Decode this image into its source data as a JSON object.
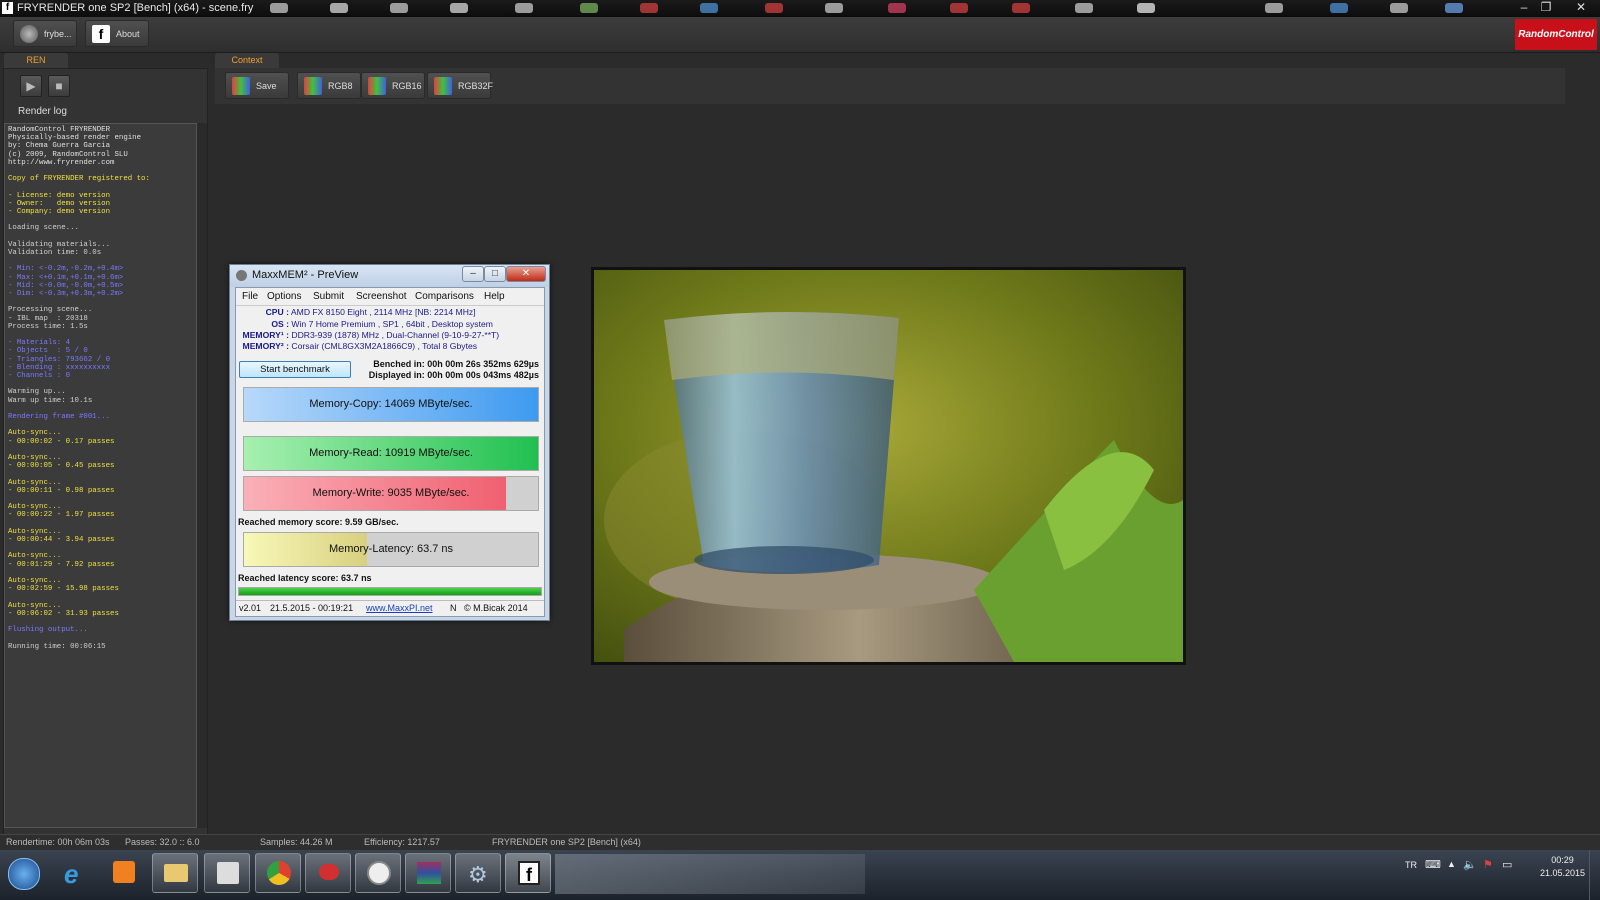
{
  "window": {
    "title": "FRYRENDER one SP2 [Bench] (x64) - scene.fry",
    "controls": [
      "–",
      "❐",
      "✕"
    ]
  },
  "toolbar": {
    "user_label": "frybe...",
    "about_label": "About",
    "brand": "RandomControl"
  },
  "left": {
    "tab": "REN",
    "render_log_label": "Render log",
    "log": [
      {
        "t": "RandomControl FRYRENDER",
        "c": "w"
      },
      {
        "t": "Physically-based render engine",
        "c": "w"
      },
      {
        "t": "by: Chema Guerra Garcia",
        "c": "w"
      },
      {
        "t": "(c) 2009, RandomControl SLU",
        "c": "w"
      },
      {
        "t": "http://www.fryrender.com",
        "c": "w"
      },
      {
        "t": "",
        "c": "w"
      },
      {
        "t": "Copy of FRYRENDER registered to:",
        "c": "y"
      },
      {
        "t": "",
        "c": "w"
      },
      {
        "t": "- License: demo version",
        "c": "y"
      },
      {
        "t": "- Owner:   demo version",
        "c": "y"
      },
      {
        "t": "- Company: demo version",
        "c": "y"
      },
      {
        "t": "",
        "c": "w"
      },
      {
        "t": "Loading scene...",
        "c": "g"
      },
      {
        "t": "",
        "c": "w"
      },
      {
        "t": "Validating materials...",
        "c": "g"
      },
      {
        "t": "Validation time: 0.0s",
        "c": "g"
      },
      {
        "t": "",
        "c": "w"
      },
      {
        "t": "- Min: <-0.2m,-0.2m,+0.4m>",
        "c": "b"
      },
      {
        "t": "- Max: <+0.1m,+0.1m,+0.6m>",
        "c": "b"
      },
      {
        "t": "- Mid: <-0.0m,-0.0m,+0.5m>",
        "c": "b"
      },
      {
        "t": "- Dim: <-0.3m,+0.3m,+0.2m>",
        "c": "b"
      },
      {
        "t": "",
        "c": "w"
      },
      {
        "t": "Processing scene...",
        "c": "g"
      },
      {
        "t": "- IBL map  : 20318",
        "c": "g"
      },
      {
        "t": "Process time: 1.5s",
        "c": "g"
      },
      {
        "t": "",
        "c": "w"
      },
      {
        "t": "- Materials: 4",
        "c": "b"
      },
      {
        "t": "- Objects  : 5 / 0",
        "c": "b"
      },
      {
        "t": "- Triangles: 793662 / 0",
        "c": "b"
      },
      {
        "t": "- Blending : xxxxxxxxxx",
        "c": "b"
      },
      {
        "t": "- Channels : 0",
        "c": "b"
      },
      {
        "t": "",
        "c": "w"
      },
      {
        "t": "Warming up...",
        "c": "g"
      },
      {
        "t": "Warm up time: 10.1s",
        "c": "g"
      },
      {
        "t": "",
        "c": "w"
      },
      {
        "t": "Rendering frame #001...",
        "c": "b"
      },
      {
        "t": "",
        "c": "w"
      },
      {
        "t": "Auto-sync...",
        "c": "y"
      },
      {
        "t": "- 00:00:02 - 0.17 passes",
        "c": "y"
      },
      {
        "t": "",
        "c": "w"
      },
      {
        "t": "Auto-sync...",
        "c": "y"
      },
      {
        "t": "- 00:00:05 - 0.45 passes",
        "c": "y"
      },
      {
        "t": "",
        "c": "w"
      },
      {
        "t": "Auto-sync...",
        "c": "y"
      },
      {
        "t": "- 00:00:11 - 0.98 passes",
        "c": "y"
      },
      {
        "t": "",
        "c": "w"
      },
      {
        "t": "Auto-sync...",
        "c": "y"
      },
      {
        "t": "- 00:00:22 - 1.97 passes",
        "c": "y"
      },
      {
        "t": "",
        "c": "w"
      },
      {
        "t": "Auto-sync...",
        "c": "y"
      },
      {
        "t": "- 00:00:44 - 3.94 passes",
        "c": "y"
      },
      {
        "t": "",
        "c": "w"
      },
      {
        "t": "Auto-sync...",
        "c": "y"
      },
      {
        "t": "- 00:01:29 - 7.92 passes",
        "c": "y"
      },
      {
        "t": "",
        "c": "w"
      },
      {
        "t": "Auto-sync...",
        "c": "y"
      },
      {
        "t": "- 00:02:59 - 15.98 passes",
        "c": "y"
      },
      {
        "t": "",
        "c": "w"
      },
      {
        "t": "Auto-sync...",
        "c": "y"
      },
      {
        "t": "- 00:06:02 - 31.93 passes",
        "c": "y"
      },
      {
        "t": "",
        "c": "w"
      },
      {
        "t": "Flushing output...",
        "c": "b"
      },
      {
        "t": "",
        "c": "w"
      },
      {
        "t": "Running time: 00:06:15",
        "c": "g"
      }
    ]
  },
  "context": {
    "tab": "Context",
    "buttons": [
      "Save",
      "RGB8",
      "RGB16",
      "RGB32F"
    ]
  },
  "maxxmem": {
    "title": "MaxxMEM² - PreView",
    "menu": [
      "File",
      "Options",
      "Submit",
      "Screenshot",
      "Comparisons",
      "Help"
    ],
    "sys": [
      {
        "k": "CPU :",
        "v": "AMD FX 8150 Eight , 2114 MHz  [NB: 2214 MHz]"
      },
      {
        "k": "OS :",
        "v": "Win 7 Home Premium , SP1 , 64bit , Desktop system"
      },
      {
        "k": "MEMORY¹ :",
        "v": "DDR3-939 (1878) MHz , Dual-Channel (9-10-9-27-**T)"
      },
      {
        "k": "MEMORY² :",
        "v": "Corsair (CML8GX3M2A1866C9) , Total 8 Gbytes"
      }
    ],
    "start_button": "Start benchmark",
    "benched": "Benched in: 00h 00m 26s 352ms 629µs",
    "displayed": "Displayed in: 00h 00m 00s 043ms 482µs",
    "copy": {
      "label": "Memory-Copy: 14069 MByte/sec.",
      "fill": 1.0
    },
    "read": {
      "label": "Memory-Read: 10919 MByte/sec.",
      "fill": 1.0
    },
    "write": {
      "label": "Memory-Write: 9035 MByte/sec.",
      "fill": 0.89
    },
    "mem_score": "Reached memory score: 9.59 GB/sec.",
    "latency": {
      "label": "Memory-Latency: 63.7 ns",
      "fill": 0.42
    },
    "lat_score": "Reached latency score: 63.7 ns",
    "progress": 1.0,
    "footer": {
      "version": "v2.01",
      "date": "21.5.2015 - 00:19:21",
      "link": "www.MaxxPI.net",
      "n": "N",
      "copy": "© M.Bicak 2014"
    },
    "colors": {
      "copy": "#3d9af0",
      "read": "#20c050",
      "write": "#f06070",
      "latency": "#f0f080"
    }
  },
  "status": {
    "rendertime": "Rendertime: 00h 06m 03s",
    "passes": "Passes: 32.0 :: 6.0",
    "samples": "Samples: 44.26 M",
    "efficiency": "Efficiency: 1217.57",
    "product": "FRYRENDER one SP2 [Bench] (x64)"
  },
  "taskbar": {
    "lang": "TR",
    "time": "00:29",
    "date": "21.05.2015"
  }
}
